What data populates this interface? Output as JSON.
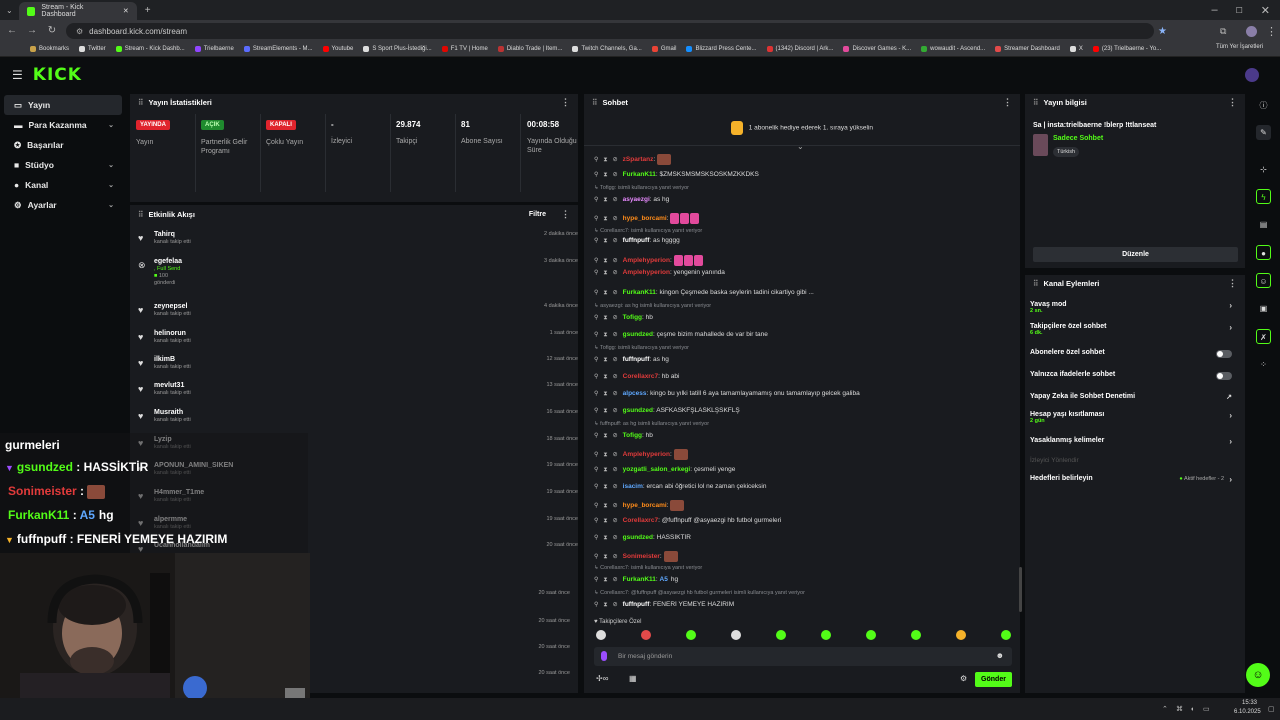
{
  "browser": {
    "tab_title": "Stream - Kick Dashboard",
    "url": "dashboard.kick.com/stream",
    "bookmarks": [
      "Bookmarks",
      "Twitter",
      "Stream - Kick Dashb...",
      "Trielbaerne",
      "StreamElements - M...",
      "Youtube",
      "S Sport Plus-İstediği...",
      "F1 TV | Home",
      "Diablo Trade | Item...",
      "Twitch Channels, Ga...",
      "Gmail",
      "Blizzard Press Cente...",
      "(1342) Discord | Ark...",
      "Discover Games - K...",
      "wowaudit - Ascend...",
      "Streamer Dashboard",
      "X",
      "(23) Trielbaerne - Yo..."
    ],
    "bookmarks_right": "Tüm Yer İşaretleri"
  },
  "sidebar": {
    "items": [
      {
        "label": "Yayın"
      },
      {
        "label": "Para Kazanma"
      },
      {
        "label": "Başarılar"
      },
      {
        "label": "Stüdyo"
      },
      {
        "label": "Kanal"
      },
      {
        "label": "Ayarlar"
      }
    ]
  },
  "stats": {
    "title": "Yayın İstatistikleri",
    "cells": [
      {
        "value": "YAYINDA",
        "label": "Yayın",
        "color": "#e0242d"
      },
      {
        "value": "AÇIK",
        "label": "Partnerlik Gelir Programı",
        "color": "#1f8a2e"
      },
      {
        "value": "KAPALI",
        "label": "Çoklu Yayın",
        "color": "#e0242d"
      },
      {
        "value": "-",
        "label": "İzleyici"
      },
      {
        "value": "29.874",
        "label": "Takipçi"
      },
      {
        "value": "81",
        "label": "Abone Sayısı"
      },
      {
        "value": "00:08:58",
        "label": "Yayında Olduğu Süre"
      }
    ]
  },
  "activity": {
    "title": "Etkinlik Akışı",
    "filter": "Filtre",
    "items": [
      {
        "name": "Tahirq",
        "sub": "kanalı takip etti",
        "time": "2 dakika önce"
      },
      {
        "name": "egefelaa",
        "sub": ", Full Send",
        "extra": "100",
        "extra2": "gönderdi",
        "time": "3 dakika önce"
      },
      {
        "name": "zeynepsel",
        "sub": "kanalı takip etti",
        "time": "4 dakika önce"
      },
      {
        "name": "helinorun",
        "sub": "kanalı takip etti",
        "time": "1 saat önce"
      },
      {
        "name": "ilkimB",
        "sub": "kanalı takip etti",
        "time": "12 saat önce"
      },
      {
        "name": "mevlut31",
        "sub": "kanalı takip etti",
        "time": "13 saat önce"
      },
      {
        "name": "Musraith",
        "sub": "kanalı takip etti",
        "time": "16 saat önce"
      },
      {
        "name": "Lyzip",
        "sub": "kanalı takip etti",
        "time": "18 saat önce"
      },
      {
        "name": "APONUN_AMINI_SIKEN",
        "sub": "kanalı takip etti",
        "time": "19 saat önce"
      },
      {
        "name": "H4mmer_T1me",
        "sub": "kanalı takip etti",
        "time": "19 saat önce"
      },
      {
        "name": "alpermme",
        "sub": "kanalı takip etti",
        "time": "19 saat önce"
      },
      {
        "name": "Ucanhollandalim",
        "sub": "",
        "time": "20 saat önce"
      }
    ],
    "extra_times": [
      "20 saat önce",
      "20 saat önce",
      "20 saat önce",
      "20 saat önce"
    ]
  },
  "chat": {
    "title": "Sohbet",
    "pinned": "1 abonelik hediye ederek 1. sıraya yükselin",
    "lines": [
      {
        "type": "msg",
        "user": "zSpartanz",
        "color": "#e23b3b",
        "text": "",
        "emote": true
      },
      {
        "type": "msg",
        "user": "FurkanK11",
        "color": "#53fc18",
        "text": "$ZMSKSMSMSKSOSKMZKKDKS"
      },
      {
        "type": "reply",
        "text": "Tofigg: isimli kullanıcıya yanıt veriyor"
      },
      {
        "type": "msg",
        "user": "asyaezgi",
        "color": "#e88aff",
        "text": "as hg"
      },
      {
        "type": "msg",
        "user": "hype_borcami",
        "color": "#ff8c1a",
        "text": "",
        "emotes": 3
      },
      {
        "type": "reply",
        "text": "Corellaxrc7: isimli kullanıcıya yanıt veriyor"
      },
      {
        "type": "msg",
        "user": "fuffnpuff",
        "color": "#fff",
        "text": "as hgggg"
      },
      {
        "type": "msg",
        "user": "Amplehyperion",
        "color": "#e23b3b",
        "text": "",
        "emotes": 3
      },
      {
        "type": "msg",
        "user": "Amplehyperion",
        "color": "#e23b3b",
        "text": "yengenin yanında"
      },
      {
        "type": "msg",
        "user": "FurkanK11",
        "color": "#53fc18",
        "text": "kingon Çeşmede baska seylerin tadini cikartiyo gibi ..."
      },
      {
        "type": "reply",
        "text": "asyaezgi: as hg isimli kullanıcıya yanıt veriyor"
      },
      {
        "type": "msg",
        "user": "Tofigg",
        "color": "#53fc18",
        "text": "hb"
      },
      {
        "type": "msg",
        "user": "gsundzed",
        "color": "#53fc18",
        "text": "çeşme bizim mahallede de var bir tane"
      },
      {
        "type": "reply",
        "text": "Tofigg: isimli kullanıcıya yanıt veriyor"
      },
      {
        "type": "msg",
        "user": "fuffnpuff",
        "color": "#fff",
        "text": "as hg"
      },
      {
        "type": "msg",
        "user": "Corellaxrc7",
        "color": "#e23b3b",
        "text": "hb abi"
      },
      {
        "type": "msg",
        "user": "alpcess",
        "color": "#5fa8ff",
        "text": "kingo bu yılki tatill 6 aya tamamlayamamış onu tamamlayıp gelcek galiba"
      },
      {
        "type": "msg",
        "user": "gsundzed",
        "color": "#53fc18",
        "text": "ASFKASKFŞLASKLŞSKFLŞ"
      },
      {
        "type": "reply",
        "text": "fuffnpuff: as hg isimli kullanıcıya yanıt veriyor"
      },
      {
        "type": "msg",
        "user": "Tofigg",
        "color": "#53fc18",
        "text": "hb"
      },
      {
        "type": "msg",
        "user": "Amplehyperion",
        "color": "#e23b3b",
        "text": "",
        "emote": true
      },
      {
        "type": "msg",
        "user": "yozgatli_salon_erkegi",
        "color": "#53fc18",
        "text": "çesmeli yenge"
      },
      {
        "type": "msg",
        "user": "isacim",
        "color": "#5fa8ff",
        "text": "ercan abi öğretici lol ne zaman çekiceksin"
      },
      {
        "type": "msg",
        "user": "hype_borcami",
        "color": "#ff8c1a",
        "text": "",
        "emote": true
      },
      {
        "type": "msg",
        "user": "Corellaxrc7",
        "color": "#e23b3b",
        "text": "@fuffnpuff @asyaezgi hb futbol gurmeleri"
      },
      {
        "type": "msg",
        "user": "gsundzed",
        "color": "#53fc18",
        "text": "HASSİKTİR"
      },
      {
        "type": "msg",
        "user": "Sonimeister",
        "color": "#e23b3b",
        "text": "",
        "emote": true
      },
      {
        "type": "reply",
        "text": "Corellaxrc7: isimli kullanıcıya yanıt veriyor"
      },
      {
        "type": "msg",
        "user": "FurkanK11",
        "color": "#53fc18",
        "text": "hg",
        "badge": "A5"
      },
      {
        "type": "reply",
        "text": "Corellaxrc7: @fuffnpuff @asyaezgi hb futbol gurmeleri isimli kullanıcıya yanıt veriyor"
      },
      {
        "type": "msg",
        "user": "fuffnpuff",
        "color": "#fff",
        "text": "FENERİ YEMEYE HAZIRIM"
      }
    ],
    "mode": "Takipçilere Özel",
    "input_placeholder": "Bir mesaj gönderin",
    "send": "Gönder"
  },
  "info": {
    "title": "Yayın bilgisi",
    "stream_title": "Sa | insta:trielbaerne !blerp !ttlanseat",
    "category": "Sadece Sohbet",
    "language": "Türkish",
    "edit": "Düzenle"
  },
  "actions": {
    "title": "Kanal Eylemleri",
    "items": [
      {
        "label": "Yavaş mod",
        "sub": "2 sn.",
        "kind": "chev"
      },
      {
        "label": "Takipçilere özel sohbet",
        "sub": "6 dk.",
        "kind": "chev"
      },
      {
        "label": "Abonelere özel sohbet",
        "sub": "",
        "kind": "toggle"
      },
      {
        "label": "Yalnızca ifadelerle sohbet",
        "sub": "",
        "kind": "toggle"
      },
      {
        "label": "Yapay Zeka ile Sohbet Denetimi",
        "sub": "",
        "kind": "ext"
      },
      {
        "label": "Hesap yaşı kısıtlaması",
        "sub": "2 gün",
        "kind": "chev"
      },
      {
        "label": "Yasaklanmış kelimeler",
        "sub": "",
        "kind": "chev"
      },
      {
        "label": "İzleyici Yönlendir",
        "sub": "",
        "kind": "disabled"
      },
      {
        "label": "Hedefleri belirleyin",
        "sub": "",
        "kind": "goal",
        "right": "Aktif hedefler - 2"
      }
    ]
  },
  "overlay": {
    "lines": [
      {
        "user": "",
        "text": "gurmeleri"
      },
      {
        "user": "gsundzed",
        "text": "HASSİKTİR",
        "color": "#53fc18"
      },
      {
        "user": "Sonimeister",
        "text": "",
        "color": "#e23b3b"
      },
      {
        "user": "FurkanK11",
        "text": "hg",
        "color": "#53fc18",
        "badge": "A5"
      },
      {
        "user": "fuffnpuff",
        "text": "FENERİ YEMEYE HAZIRIM",
        "color": "#fff"
      }
    ]
  },
  "taskbar": {
    "time": "15:33",
    "date": "6.10.2025"
  }
}
